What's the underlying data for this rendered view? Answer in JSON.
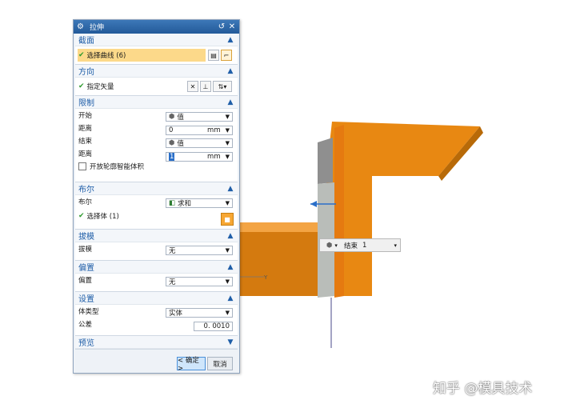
{
  "dialog": {
    "title": "拉伸",
    "sections": {
      "section": {
        "title": "截面",
        "select_curve_label": "选择曲线 (6)"
      },
      "direction": {
        "title": "方向",
        "specify_vector_label": "指定矢量"
      },
      "limits": {
        "title": "限制",
        "start_label": "开始",
        "start_value": "值",
        "start_distance_label": "距离",
        "start_distance_value": "0",
        "start_unit": "mm",
        "end_label": "结束",
        "end_value": "值",
        "end_distance_label": "距离",
        "end_distance_value": "1",
        "end_unit": "mm",
        "open_profile_label": "开放轮廓智能体积"
      },
      "boolean": {
        "title": "布尔",
        "boolean_label": "布尔",
        "boolean_value": "求和",
        "select_body_label": "选择体 (1)"
      },
      "draft": {
        "title": "拔模",
        "draft_label": "拔模",
        "draft_value": "无"
      },
      "offset": {
        "title": "偏置",
        "offset_label": "偏置",
        "offset_value": "无"
      },
      "settings": {
        "title": "设置",
        "body_type_label": "体类型",
        "body_type_value": "实体",
        "tolerance_label": "公差",
        "tolerance_value": "0. 0010"
      },
      "preview": {
        "title": "预览"
      }
    },
    "ok_label": "< 确定 >",
    "cancel_label": "取消"
  },
  "float_input": {
    "label": "结束",
    "value": "1"
  },
  "axis_label": "Y",
  "watermark": "知乎 @模具技术",
  "colors": {
    "accent": "#1f5ea8",
    "body": "#e8850f",
    "check": "#2e9a2e",
    "selection_row": "#fcd98a"
  }
}
